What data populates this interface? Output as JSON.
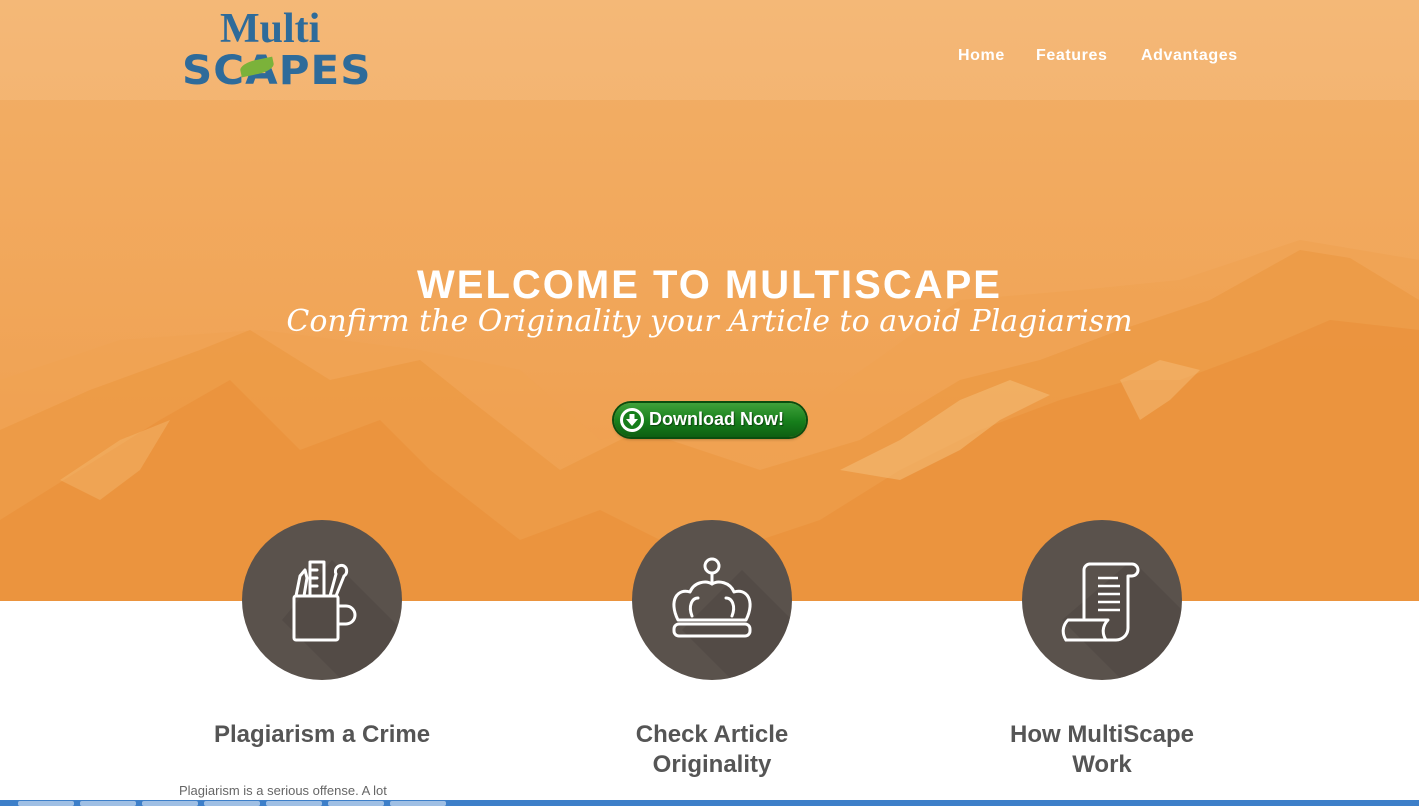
{
  "logo": {
    "line1": "Multi",
    "line2": "SCAPES"
  },
  "nav": {
    "items": [
      {
        "label": "Home"
      },
      {
        "label": "Features"
      },
      {
        "label": "Advantages"
      }
    ]
  },
  "hero": {
    "title": "WELCOME TO MULTISCAPE",
    "subtitle": "Confirm the Originality your Article to avoid Plagiarism",
    "download_label": "Download Now!"
  },
  "features": [
    {
      "icon": "pencil-cup-icon",
      "title_line1": "Plagiarism a Crime",
      "title_line2": "",
      "text": "Plagiarism is a serious offense. A lot"
    },
    {
      "icon": "crown-icon",
      "title_line1": "Check Article",
      "title_line2": "Originality",
      "text": ""
    },
    {
      "icon": "scroll-document-icon",
      "title_line1": "How MultiScape",
      "title_line2": "Work",
      "text": ""
    }
  ],
  "colors": {
    "hero_bg": "#f2a85a",
    "logo": "#2e6b9a",
    "circle": "#5a524c",
    "download_green": "#167e1b"
  }
}
